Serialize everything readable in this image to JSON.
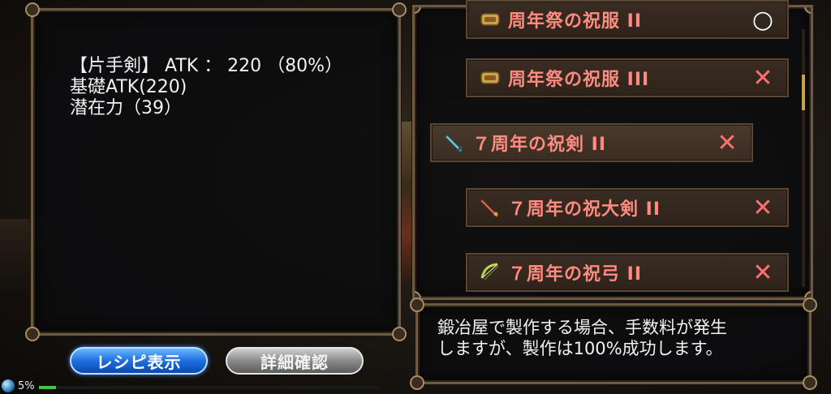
{
  "weapon_info": {
    "line1": "【片手剣】 ATK ： 220 （80%）",
    "line2": "基礎ATK(220)",
    "line3": "潜在力（39）"
  },
  "recipe_list": {
    "items": [
      {
        "name": "周年祭の祝服 II",
        "icon": "outfit-icon",
        "status": "○"
      },
      {
        "name": "周年祭の祝服 III",
        "icon": "outfit-icon",
        "status": "✕"
      },
      {
        "name": "７周年の祝剣 II",
        "icon": "sword-icon",
        "status": "✕"
      },
      {
        "name": "７周年の祝大剣 II",
        "icon": "greatsword-icon",
        "status": "✕"
      },
      {
        "name": "７周年の祝弓 II",
        "icon": "bow-icon",
        "status": "✕"
      }
    ]
  },
  "description": {
    "line1": "鍛冶屋で製作する場合、手数料が発生",
    "line2": "しますが、製作は100%成功します。"
  },
  "buttons": {
    "recipe_label": "レシピ表示",
    "detail_label": "詳細確認"
  },
  "status_bar": {
    "percent_label": "5%",
    "progress": 0.05
  },
  "colors": {
    "item_text": "#ff8a80",
    "recipe_button": "#1f6fe0",
    "detail_button": "#8a8a8a",
    "scroll_thumb": "#c8a24a"
  }
}
